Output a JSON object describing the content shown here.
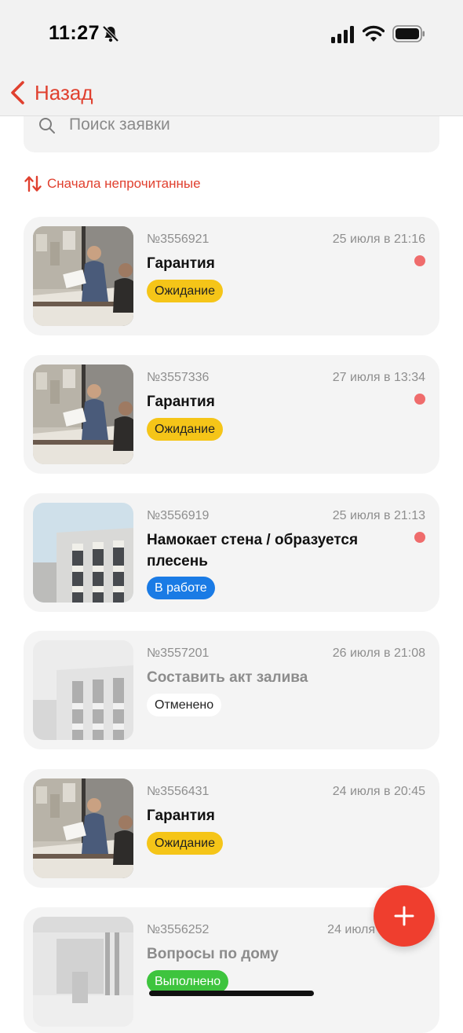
{
  "status_bar": {
    "time": "11:27"
  },
  "nav": {
    "back_label": "Назад"
  },
  "search": {
    "placeholder": "Поиск заявки",
    "value": ""
  },
  "sort": {
    "label": "Сначала непрочитанные"
  },
  "colors": {
    "accent": "#e0402f",
    "unread_dot": "#ef6c6c",
    "waiting": "#f5c518",
    "in_progress": "#1a7be5",
    "done": "#3ec43e"
  },
  "tickets": [
    {
      "number": "№3556921",
      "date": "25 июля в 21:16",
      "title": "Гарантия",
      "status": "Ожидание",
      "status_type": "waiting",
      "unread": true,
      "thumbnail": "office-people-photo"
    },
    {
      "number": "№3557336",
      "date": "27 июля в 13:34",
      "title": "Гарантия",
      "status": "Ожидание",
      "status_type": "waiting",
      "unread": true,
      "thumbnail": "office-people-photo"
    },
    {
      "number": "№3556919",
      "date": "25 июля в 21:13",
      "title": "Намокает стена / образуется плесень",
      "status": "В работе",
      "status_type": "in-progress",
      "unread": true,
      "thumbnail": "building-photo"
    },
    {
      "number": "№3557201",
      "date": "26 июля в 21:08",
      "title": "Составить акт залива",
      "status": "Отменено",
      "status_type": "cancelled",
      "unread": false,
      "thumbnail": "building-photo"
    },
    {
      "number": "№3556431",
      "date": "24 июля в 20:45",
      "title": "Гарантия",
      "status": "Ожидание",
      "status_type": "waiting",
      "unread": false,
      "thumbnail": "office-people-photo"
    },
    {
      "number": "№3556252",
      "date": "24 июля",
      "title": "Вопросы по дому",
      "status": "Выполнено",
      "status_type": "done",
      "unread": false,
      "thumbnail": "interior-photo"
    }
  ],
  "fab": {
    "icon": "plus-icon"
  }
}
